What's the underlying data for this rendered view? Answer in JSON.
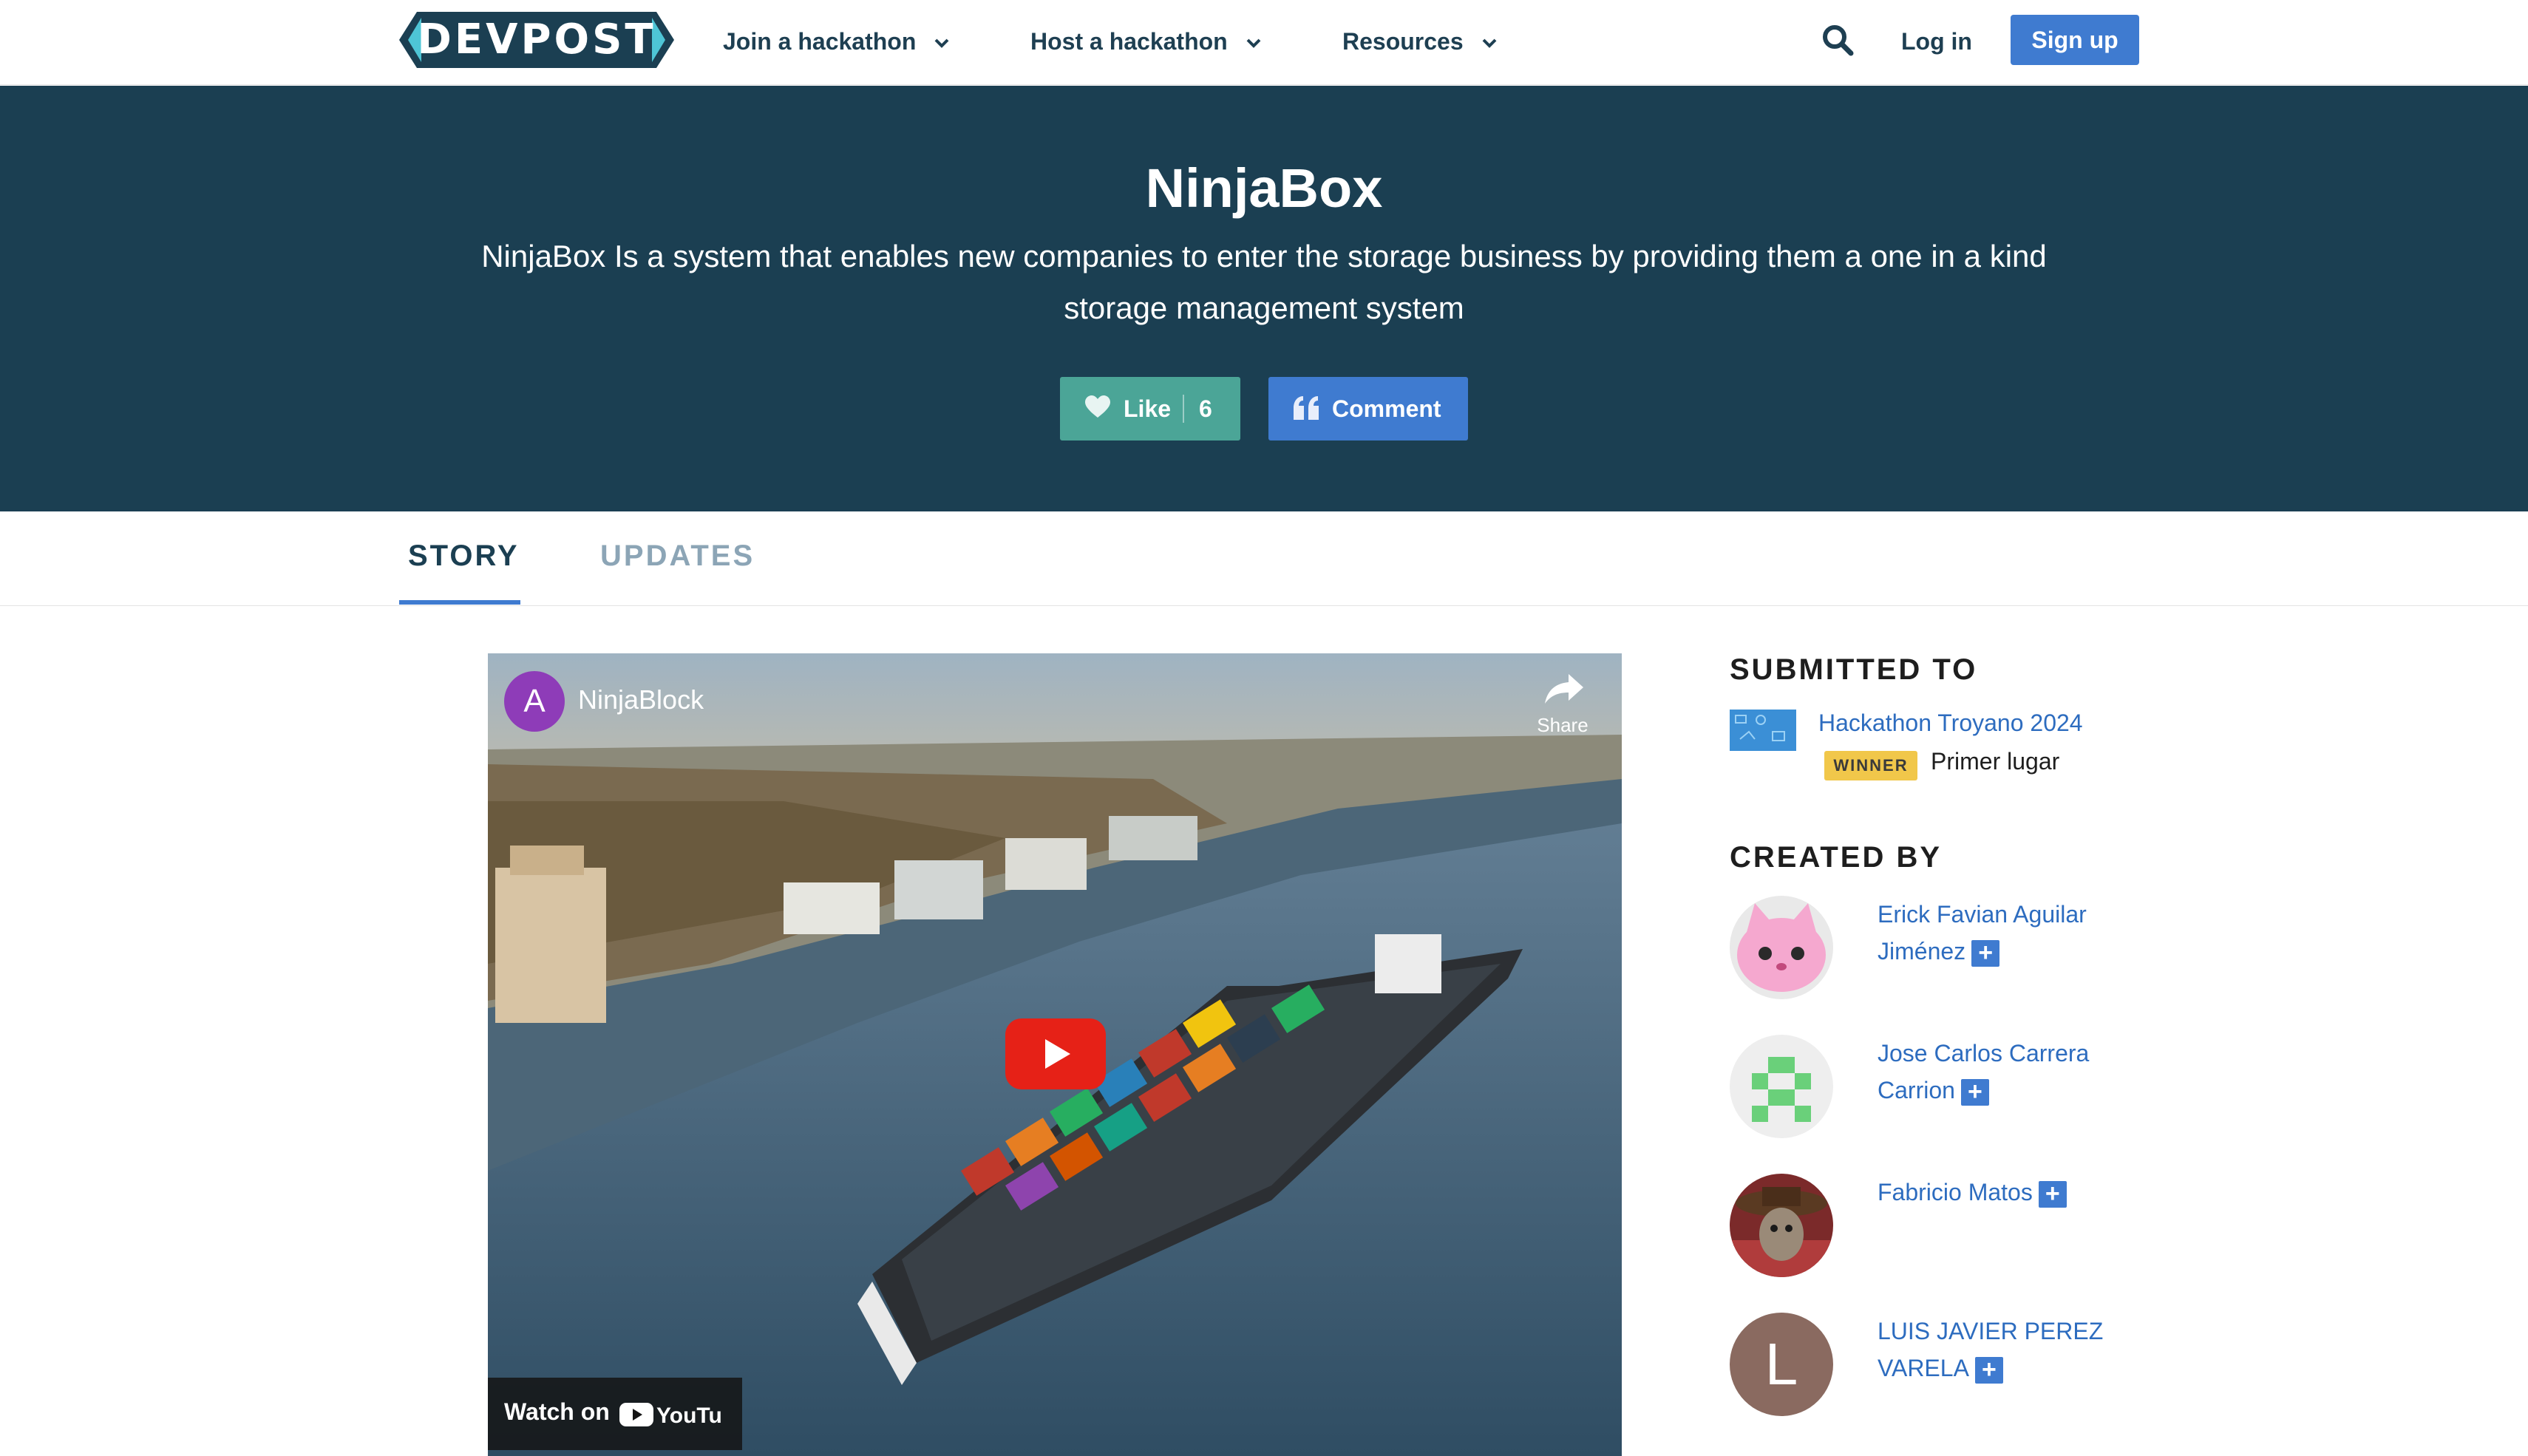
{
  "nav": {
    "logo_text": "DEVPOST",
    "join_label": "Join a hackathon",
    "host_label": "Host a hackathon",
    "resources_label": "Resources",
    "login_label": "Log in",
    "signup_label": "Sign up"
  },
  "hero": {
    "title": "NinjaBox",
    "tagline": "NinjaBox Is a system that enables new companies to enter the storage business by providing them a one in a kind storage management system",
    "like_label": "Like",
    "like_count": "6",
    "comment_label": "Comment"
  },
  "tabs": [
    {
      "label": "STORY",
      "active": true
    },
    {
      "label": "UPDATES",
      "active": false
    }
  ],
  "video": {
    "channel_initial": "A",
    "channel_name": "NinjaBlock",
    "share_label": "Share",
    "watch_on_label": "Watch on",
    "youtube_label": "YouTube"
  },
  "sidebar": {
    "submitted_heading": "SUBMITTED TO",
    "hackathon_name": "Hackathon Troyano 2024",
    "winner_badge": "WINNER",
    "prize": "Primer lugar",
    "created_heading": "CREATED BY",
    "members": [
      {
        "name": "Erick Favian Aguilar Jiménez"
      },
      {
        "name": "Jose Carlos Carrera Carrion"
      },
      {
        "name": "Fabricio Matos"
      },
      {
        "name": "LUIS JAVIER PEREZ VARELA",
        "initial": "L"
      }
    ]
  },
  "colors": {
    "hero_bg": "#1b3f52",
    "primary_blue": "#3f7bd0",
    "like_green": "#4ba597",
    "winner_yellow": "#f1c74a"
  }
}
